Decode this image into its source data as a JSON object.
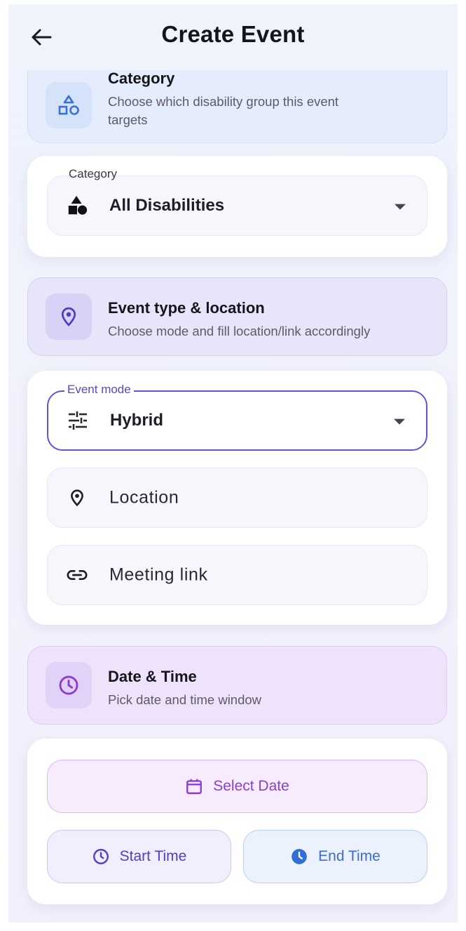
{
  "appbar": {
    "title": "Create Event",
    "back_icon": "arrow-back-icon"
  },
  "sections": {
    "category": {
      "title": "Category",
      "subtitle_line1": "Choose which disability group this event",
      "subtitle_line2": "targets",
      "icon": "shapes-icon"
    },
    "event_type": {
      "title": "Event type & location",
      "subtitle": "Choose mode and fill location/link accordingly",
      "icon": "location-pin-icon"
    },
    "date_time": {
      "title": "Date & Time",
      "subtitle": "Pick date and time window",
      "icon": "clock-icon"
    }
  },
  "category_field": {
    "label": "Category",
    "value": "All Disabilities",
    "icon": "category-shapes-icon"
  },
  "event_mode_field": {
    "label": "Event mode",
    "value": "Hybrid",
    "icon": "tune-icon"
  },
  "location_field": {
    "placeholder": "Location",
    "icon": "location-pin-icon"
  },
  "meeting_link_field": {
    "placeholder": "Meeting link",
    "icon": "link-icon"
  },
  "buttons": {
    "select_date": "Select Date",
    "start_time": "Start Time",
    "end_time": "End Time"
  },
  "colors": {
    "accent": "#6a4fd6",
    "purple": "#8b3fd0",
    "blue": "#3f6fd9",
    "blue_solid": "#2f6fd6",
    "category_header_bg": "#e4ecfb",
    "event_header_bg": "#e9e6fa",
    "date_header_bg": "#efe4fb"
  }
}
